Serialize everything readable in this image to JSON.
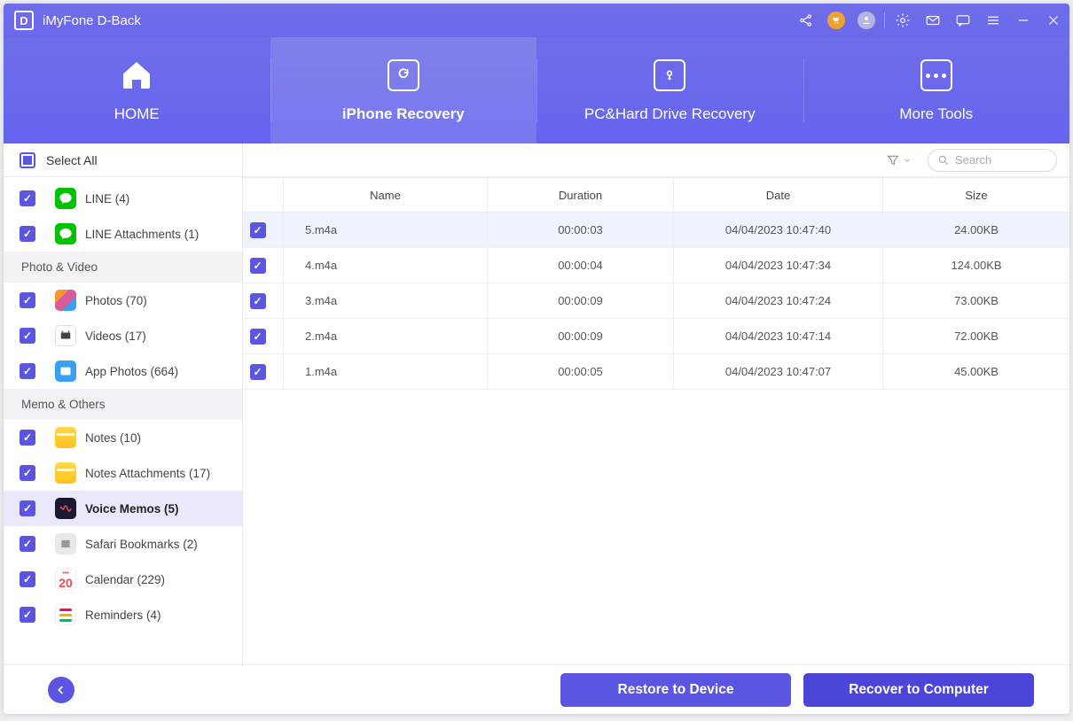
{
  "title": "iMyFone D-Back",
  "logo_letter": "D",
  "nav": {
    "home": "HOME",
    "iphone": "iPhone Recovery",
    "pc": "PC&Hard Drive Recovery",
    "more": "More Tools"
  },
  "sidebar": {
    "select_all": "Select All",
    "items": {
      "line": {
        "label": "LINE (4)"
      },
      "line_att": {
        "label": "LINE Attachments (1)"
      },
      "cat_photo": "Photo & Video",
      "photos": {
        "label": "Photos (70)"
      },
      "videos": {
        "label": "Videos (17)"
      },
      "appphotos": {
        "label": "App Photos (664)"
      },
      "cat_memo": "Memo & Others",
      "notes": {
        "label": "Notes (10)"
      },
      "notes_att": {
        "label": "Notes Attachments (17)"
      },
      "voice": {
        "label": "Voice Memos (5)",
        "active": true
      },
      "safari": {
        "label": "Safari Bookmarks (2)"
      },
      "cal": {
        "label": "Calendar (229)",
        "badge": "20"
      },
      "rem": {
        "label": "Reminders (4)"
      }
    }
  },
  "main": {
    "search_placeholder": "Search",
    "columns": {
      "name": "Name",
      "duration": "Duration",
      "date": "Date",
      "size": "Size"
    },
    "rows": [
      {
        "name": "5.m4a",
        "duration": "00:00:03",
        "date": "04/04/2023 10:47:40",
        "size": "24.00KB"
      },
      {
        "name": "4.m4a",
        "duration": "00:00:04",
        "date": "04/04/2023 10:47:34",
        "size": "124.00KB"
      },
      {
        "name": "3.m4a",
        "duration": "00:00:09",
        "date": "04/04/2023 10:47:24",
        "size": "73.00KB"
      },
      {
        "name": "2.m4a",
        "duration": "00:00:09",
        "date": "04/04/2023 10:47:14",
        "size": "72.00KB"
      },
      {
        "name": "1.m4a",
        "duration": "00:00:05",
        "date": "04/04/2023 10:47:07",
        "size": "45.00KB"
      }
    ]
  },
  "footer": {
    "restore": "Restore to Device",
    "recover": "Recover to Computer"
  }
}
